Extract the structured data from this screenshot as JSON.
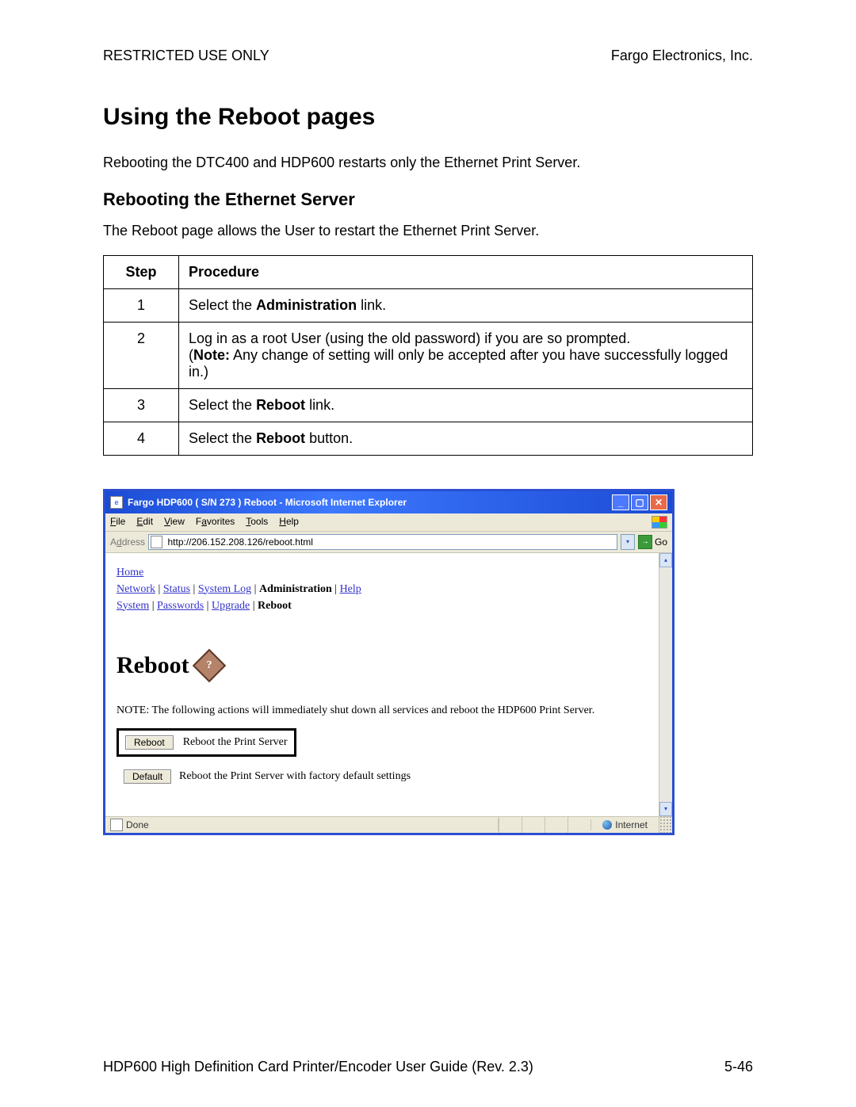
{
  "header": {
    "left": "RESTRICTED USE ONLY",
    "right": "Fargo Electronics, Inc."
  },
  "h1": "Using the Reboot pages",
  "intro": "Rebooting the DTC400 and HDP600 restarts only the Ethernet Print Server.",
  "h2": "Rebooting the Ethernet Server",
  "subintro": "The Reboot page allows the User to restart the Ethernet Print Server.",
  "table": {
    "head_step": "Step",
    "head_proc": "Procedure",
    "rows": [
      {
        "n": "1",
        "prefix": "Select the ",
        "bold": "Administration",
        "suffix": " link."
      },
      {
        "n": "2",
        "line1": "Log in as a root User (using the old password) if you are so prompted.",
        "noteLabel": "Note:",
        "noteRest": " Any change of setting will only be accepted after you have successfully logged in.)"
      },
      {
        "n": "3",
        "prefix": "Select the ",
        "bold": "Reboot",
        "suffix": " link."
      },
      {
        "n": "4",
        "prefix": "Select the ",
        "bold": "Reboot",
        "suffix": " button."
      }
    ]
  },
  "ie": {
    "title": "Fargo HDP600 ( S/N 273 ) Reboot - Microsoft Internet Explorer",
    "menu": [
      "File",
      "Edit",
      "View",
      "Favorites",
      "Tools",
      "Help"
    ],
    "menu_accel": [
      "F",
      "E",
      "V",
      "a",
      "T",
      "H"
    ],
    "addressLabel": "Address",
    "url": "http://206.152.208.126/reboot.html",
    "go": "Go",
    "nav": {
      "home": "Home",
      "row1": [
        "Network",
        "Status",
        "System Log"
      ],
      "row1_bold": "Administration",
      "row1_tail": [
        "Help"
      ],
      "row2": [
        "System",
        "Passwords",
        "Upgrade"
      ],
      "row2_bold": "Reboot"
    },
    "rebootHeading": "Reboot",
    "note": "NOTE: The following actions will immediately shut down all services and reboot the HDP600 Print Server.",
    "btnReboot": "Reboot",
    "descReboot": "Reboot the Print Server",
    "btnDefault": "Default",
    "descDefault": "Reboot the Print Server with factory default settings",
    "statusLeft": "Done",
    "statusZone": "Internet"
  },
  "footer": {
    "left": "HDP600 High Definition Card Printer/Encoder User Guide (Rev. 2.3)",
    "right": "5-46"
  }
}
